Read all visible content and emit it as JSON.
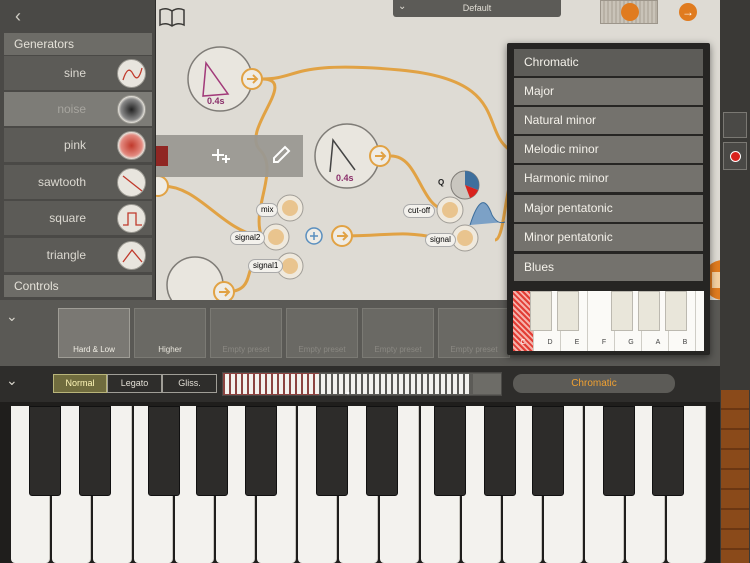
{
  "top": {
    "preset_name": "Default",
    "icons": [
      "book-icon",
      "chevron-down-icon",
      "export-icon",
      "arrow-right-icon"
    ]
  },
  "sidebar": {
    "back_icon": "chevron-left-icon",
    "generators_header": "Generators",
    "controls_header": "Controls",
    "items": [
      {
        "label": "sine",
        "icon": "sine-wave-icon"
      },
      {
        "label": "noise",
        "icon": "noise-icon",
        "selected": true
      },
      {
        "label": "pink",
        "icon": "pink-noise-icon"
      },
      {
        "label": "sawtooth",
        "icon": "sawtooth-wave-icon"
      },
      {
        "label": "square",
        "icon": "square-wave-icon"
      },
      {
        "label": "triangle",
        "icon": "triangle-wave-icon"
      }
    ]
  },
  "canvas": {
    "env1_label": "0.4s",
    "env2_label": "0.4s",
    "mixer": {
      "mix": "mix",
      "signal2": "signal2",
      "signal1": "signal1"
    },
    "filter": {
      "q": "Q",
      "cutoff": "cut-off",
      "signal": "signal"
    }
  },
  "presets": {
    "items": [
      "Hard & Low",
      "Higher",
      "Empty preset",
      "Empty preset",
      "Empty preset",
      "Empty preset"
    ]
  },
  "keyboard_bar": {
    "modes": [
      "Normal",
      "Legato",
      "Gliss."
    ],
    "selected_mode": "Normal",
    "scale": "Chromatic"
  },
  "scale_menu": {
    "items": [
      "Chromatic",
      "Major",
      "Natural minor",
      "Melodic minor",
      "Harmonic minor",
      "Major pentatonic",
      "Minor pentatonic",
      "Blues"
    ],
    "selected": "Chromatic",
    "note_names": [
      "C",
      "D",
      "E",
      "F",
      "G",
      "A",
      "B"
    ]
  },
  "colors": {
    "accent": "#f0a132",
    "wire": "#e1a244",
    "highlight_red": "#e23d34",
    "record_red": "#d9221d"
  }
}
